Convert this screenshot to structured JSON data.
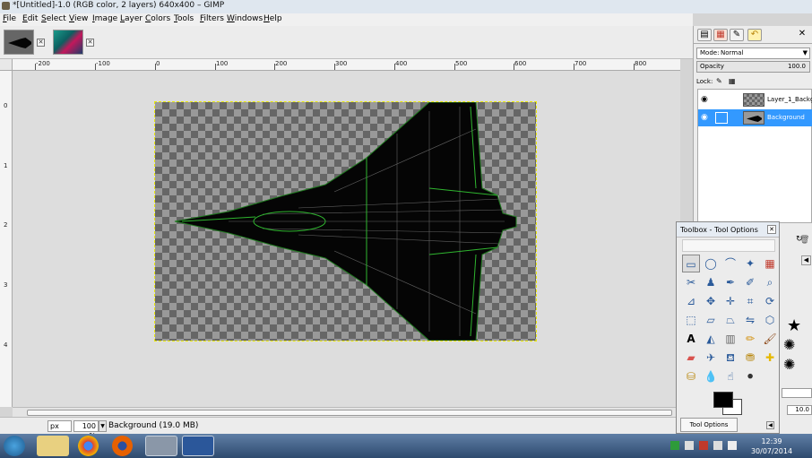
{
  "window": {
    "title": "*[Untitled]-1.0 (RGB color, 2 layers) 640x400 – GIMP"
  },
  "menu": [
    "File",
    "Edit",
    "Select",
    "View",
    "Image",
    "Layer",
    "Colors",
    "Tools",
    "Filters",
    "Windows",
    "Help"
  ],
  "ruler": {
    "top_labels": [
      "-200",
      "-100",
      "0",
      "100",
      "200",
      "300",
      "400",
      "500",
      "600",
      "700",
      "800"
    ],
    "left_labels": [
      "0",
      "1",
      "2",
      "3",
      "4"
    ]
  },
  "status": {
    "unit": "px",
    "zoom": "100 %",
    "layer_info": "Background (19.0 MB)"
  },
  "layers_panel": {
    "mode_label": "Mode:",
    "mode_value": "Normal",
    "opacity_label": "Opacity",
    "opacity_value": "100.0",
    "lock_label": "Lock:",
    "layers": [
      {
        "name": "Layer_1_Backgro",
        "selected": false
      },
      {
        "name": "Background",
        "selected": true
      }
    ]
  },
  "toolbox": {
    "title": "Toolbox - Tool Options",
    "tab_label": "Tool Options"
  },
  "side_values": {
    "size_value": "10.0"
  },
  "taskbar": {
    "time": "12:39",
    "date": "30/07/2014"
  },
  "colors": {
    "selection": "#3399ff",
    "foreground": "#000000",
    "background": "#ffffff"
  }
}
